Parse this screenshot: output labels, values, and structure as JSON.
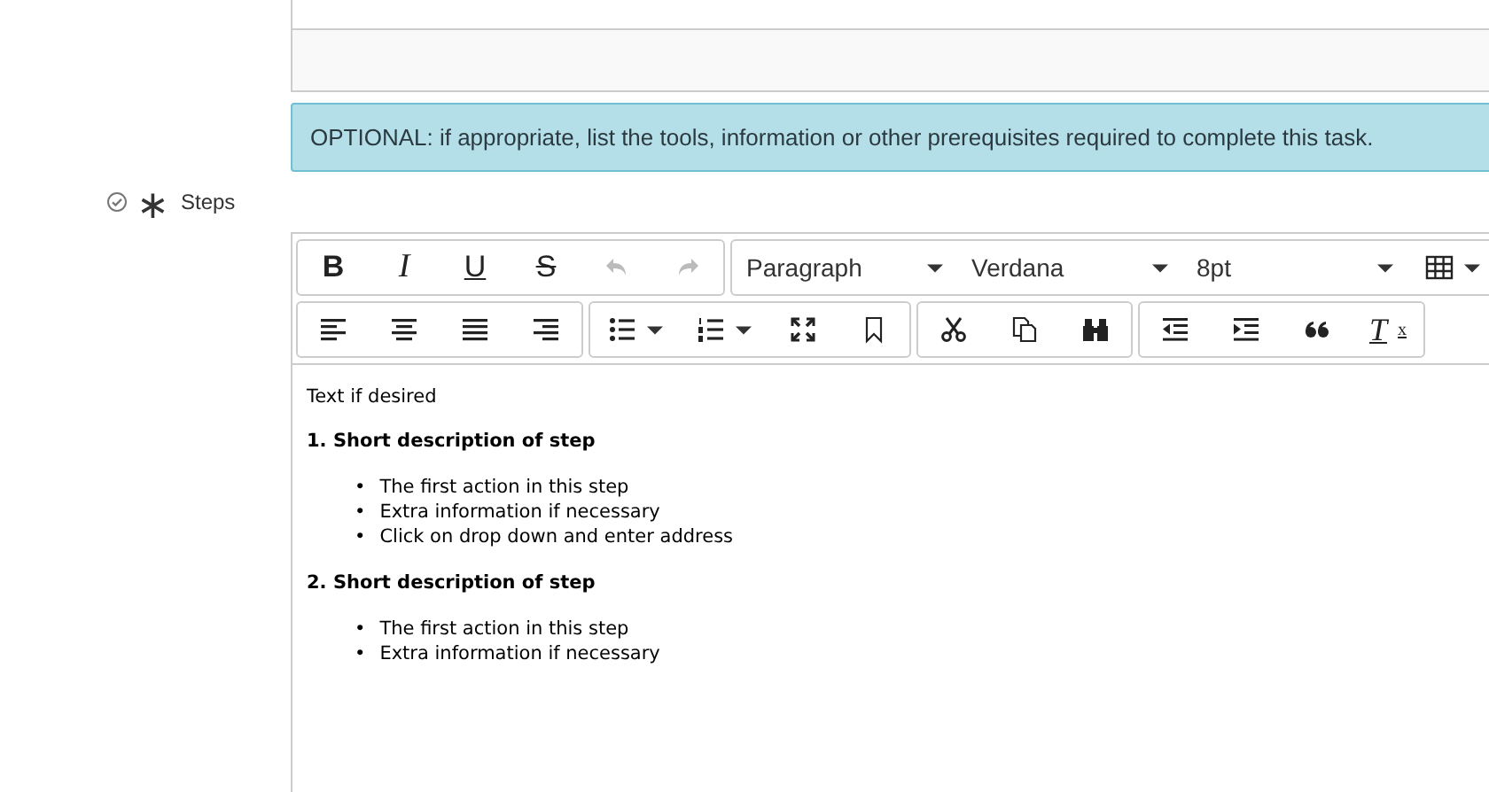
{
  "hint": "OPTIONAL: if appropriate, list the tools, information or other prerequisites required to complete this task.",
  "field": {
    "label": "Steps",
    "required_mark": "∗",
    "validated": true
  },
  "toolbar": [
    [
      {
        "items": [
          {
            "kind": "bold",
            "label": "B"
          },
          {
            "kind": "italic",
            "label": "I"
          },
          {
            "kind": "underline",
            "label": "U"
          },
          {
            "kind": "strike",
            "label": "S"
          },
          {
            "kind": "undo",
            "disabled": true
          },
          {
            "kind": "redo",
            "disabled": true
          }
        ]
      },
      {
        "items": [
          {
            "kind": "select",
            "value": "Paragraph"
          },
          {
            "kind": "select",
            "value": "Verdana"
          },
          {
            "kind": "select",
            "value": "8pt"
          },
          {
            "kind": "table"
          }
        ]
      }
    ],
    [
      {
        "items": [
          {
            "kind": "alignleft"
          },
          {
            "kind": "aligncenter"
          },
          {
            "kind": "justify"
          },
          {
            "kind": "alignright"
          }
        ]
      },
      {
        "items": [
          {
            "kind": "bullets"
          },
          {
            "kind": "numbers"
          },
          {
            "kind": "fullscreen"
          },
          {
            "kind": "bookmark"
          }
        ]
      },
      {
        "items": [
          {
            "kind": "cut"
          },
          {
            "kind": "copy"
          },
          {
            "kind": "find"
          }
        ]
      },
      {
        "items": [
          {
            "kind": "outdent"
          },
          {
            "kind": "indent"
          },
          {
            "kind": "quote"
          },
          {
            "kind": "clearformat",
            "label": "T",
            "sub": "x"
          }
        ]
      }
    ]
  ],
  "content": [
    {
      "kind": "para",
      "text": "Text if desired"
    },
    {
      "kind": "heading",
      "text": "1. Short description of step"
    },
    {
      "kind": "list",
      "marker": "•",
      "items": [
        "The first action in this step",
        "Extra information if necessary",
        "Click on drop down and enter address"
      ]
    },
    {
      "kind": "heading",
      "text": "2. Short description of step"
    },
    {
      "kind": "list",
      "marker": "•",
      "items": [
        "The first action in this step",
        "Extra information if necessary"
      ]
    }
  ]
}
